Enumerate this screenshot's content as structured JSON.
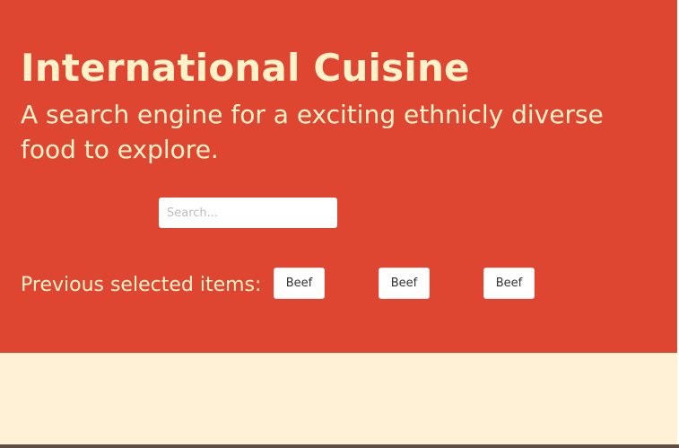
{
  "header": {
    "title": "International Cuisine",
    "subtitle": "A search engine for a exciting ethnicly diverse food to explore."
  },
  "search": {
    "value": "",
    "placeholder": "Search..."
  },
  "previous": {
    "label": "Previous selected items:",
    "items": [
      {
        "label": "Beef"
      },
      {
        "label": "Beef"
      },
      {
        "label": "Beef"
      }
    ]
  },
  "colors": {
    "hero_background": "#de4632",
    "page_background": "#fff1d6",
    "heading_text": "#fff1c8",
    "button_background": "#ffffff"
  }
}
